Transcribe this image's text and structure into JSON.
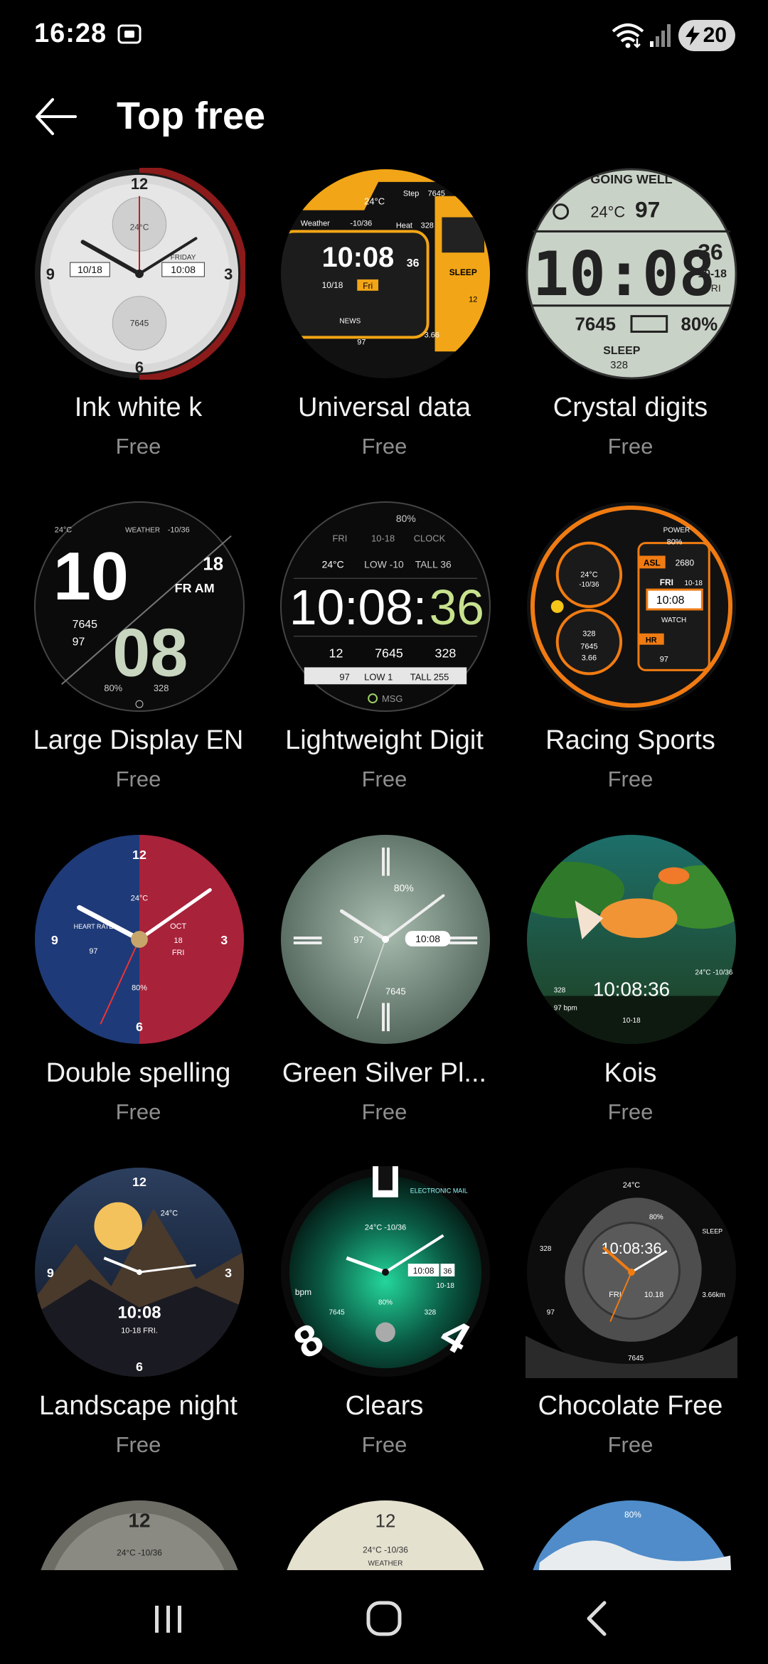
{
  "status": {
    "time": "16:28",
    "battery": "20"
  },
  "header": {
    "title": "Top free"
  },
  "faces": [
    {
      "name": "Ink white k",
      "price": "Free"
    },
    {
      "name": "Universal data",
      "price": "Free"
    },
    {
      "name": "Crystal digits",
      "price": "Free"
    },
    {
      "name": "Large Display EN",
      "price": "Free"
    },
    {
      "name": "Lightweight Digit",
      "price": "Free"
    },
    {
      "name": "Racing Sports",
      "price": "Free"
    },
    {
      "name": "Double spelling",
      "price": "Free"
    },
    {
      "name": "Green Silver Pl...",
      "price": "Free"
    },
    {
      "name": "Kois",
      "price": "Free"
    },
    {
      "name": "Landscape night",
      "price": "Free"
    },
    {
      "name": "Clears",
      "price": "Free"
    },
    {
      "name": "Chocolate Free",
      "price": "Free"
    }
  ],
  "face_text": {
    "f1": {
      "n12": "12",
      "n3": "3",
      "n6": "6",
      "n9": "9",
      "date": "10/18",
      "day": "FRIDAY",
      "temp": "24°C",
      "steps": "7645",
      "time": "10:08"
    },
    "f2": {
      "time": "10:08",
      "sec": "36",
      "date": "10/18",
      "day": "Fri",
      "temp": "24°C",
      "weather": "Weather",
      "range": "-10/36",
      "step_label": "Step",
      "steps": "7645",
      "heat_label": "Heat",
      "heat": "328",
      "sleep": "SLEEP",
      "sleep_val": "12",
      "bpm": "97",
      "km": "3.66",
      "news": "NEWS"
    },
    "f3": {
      "banner": "GOING WELL",
      "temp": "24°C",
      "bpm": "97",
      "time": "10:08",
      "sec": "36",
      "date": "10-18",
      "day": "FRI",
      "steps": "7645",
      "battery": "80%",
      "sleep": "SLEEP",
      "sleep_val": "328"
    },
    "f4": {
      "hour": "10",
      "min": "08",
      "day": "18",
      "ampm": "FR AM",
      "temp": "24°C",
      "weather": "WEATHER",
      "range": "-10/36",
      "steps": "7645",
      "hr": "97",
      "battery": "80%",
      "cal": "328"
    },
    "f5": {
      "battery": "80%",
      "day": "FRI",
      "date": "10-18",
      "clock": "CLOCK",
      "temp": "24°C",
      "low": "LOW -10",
      "tall": "TALL 36",
      "time": "10:08:",
      "sec": "36",
      "steps": "7645",
      "cal": "328",
      "floors": "12",
      "hr": "97",
      "low2": "LOW  1",
      "tall2": "TALL 255",
      "msg": "MSG"
    },
    "f6": {
      "power": "POWER",
      "battery": "80%",
      "asl": "ASL",
      "alt": "2680",
      "day": "FRI",
      "date": "10-18",
      "time": "10:08",
      "watch": "WATCH",
      "temp": "24°C",
      "range": "-10/36",
      "kcal": "328",
      "steps": "7645",
      "km": "3.66",
      "hr": "HR",
      "bpm": "97"
    },
    "f7": {
      "n12": "12",
      "n3": "3",
      "n6": "6",
      "n9": "9",
      "temp": "24°C",
      "hr": "HEART RATE",
      "hrv": "97",
      "month": "OCT",
      "date": "18",
      "day": "FRI",
      "battery": "80%"
    },
    "f8": {
      "battery": "80%",
      "hr": "97",
      "time": "10:08",
      "steps": "7645"
    },
    "f9": {
      "time": "10:08:36",
      "temp": "24°C -10/36",
      "cal": "328",
      "bpm": "97 bpm",
      "date": "10-18"
    },
    "f10": {
      "n12": "12",
      "n3": "3",
      "n6": "6",
      "n9": "9",
      "temp": "24°C",
      "time": "10:08",
      "date": "10-18 FRI."
    },
    "f11": {
      "hour_big": "8",
      "four": "4",
      "temp": "24°C -10/36",
      "time": "10:08",
      "sec": "36",
      "date": "10-18",
      "battery": "80%",
      "steps": "7645",
      "cal": "328",
      "bpm": "bpm",
      "mail": "ELECTRONIC MAIL"
    },
    "f12": {
      "temp": "24°C",
      "time": "10:08:36",
      "battery": "80%",
      "day": "FRI",
      "date": "10.18",
      "km": "3.66km",
      "steps": "7645",
      "cal": "328",
      "sleep": "SLEEP",
      "hr": "97"
    },
    "peek1": {
      "n12": "12",
      "temp": "24°C -10/36"
    },
    "peek2": {
      "n12": "12",
      "weather": "WEATHER",
      "temp": "24°C -10/36"
    },
    "peek3": {
      "battery": "80%"
    }
  }
}
